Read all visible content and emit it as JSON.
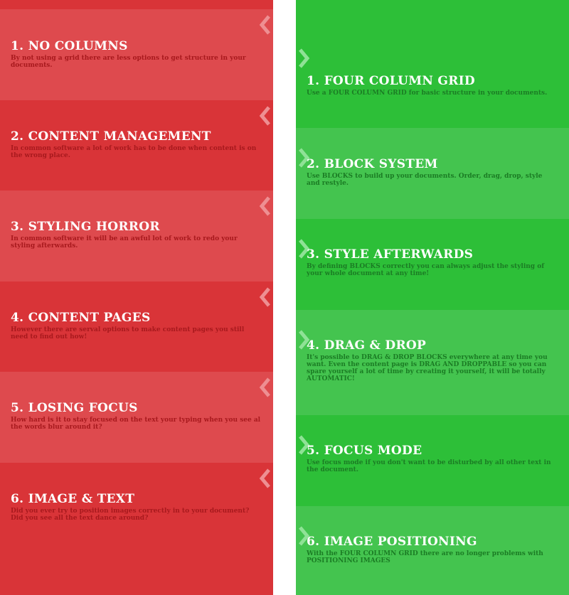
{
  "colors": {
    "problem_dark": "#d93438",
    "problem_light": "#de4a4e",
    "problem_text": "#a8191d",
    "solution_dark": "#2dbf38",
    "solution_light": "#44c44f",
    "solution_text": "#1b7c24",
    "title_text": "#ffffff"
  },
  "problems": {
    "icon": "chevron-left-icon",
    "items": [
      {
        "title": "1. NO COLUMNS",
        "description": "By not using a grid there are less options to get structure in your documents."
      },
      {
        "title": "2. CONTENT MANAGEMENT",
        "description": "In common software a lot of work has to be done when content is on the wrong place."
      },
      {
        "title": "3. STYLING HORROR",
        "description": "In common software it will be an awful lot of work to redo your styling afterwards."
      },
      {
        "title": "4. CONTENT PAGES",
        "description": "However there are serval options to make content pages you still need to find out how!"
      },
      {
        "title": "5. LOSING FOCUS",
        "description": "How hard is it to stay focused on the text your typing when you see al the words blur around it?"
      },
      {
        "title": "6. IMAGE & TEXT",
        "description": "Did you ever try to position images correctly in to your document? Did you see all the text dance around?"
      }
    ]
  },
  "solutions": {
    "icon": "chevron-right-icon",
    "items": [
      {
        "title": "1. FOUR COLUMN GRID",
        "description": "Use a FOUR COLUMN GRID for basic structure in your documents."
      },
      {
        "title": "2. BLOCK SYSTEM",
        "description": "Use BLOCKS to build up your documents. Order, drag, drop, style and restyle."
      },
      {
        "title": "3. STYLE AFTERWARDS",
        "description": "By defining BLOCKS correctly you can always adjust the styling of your whole document at any time!"
      },
      {
        "title": "4. DRAG & DROP",
        "description": "It's possible to DRAG & DROP BLOCKS everywhere at any time you want. Even the content page is DRAG AND DROPPABLE so you can spare yourself a lot of time by creating it yourself, it will be totally AUTOMATIC!"
      },
      {
        "title": "5. FOCUS MODE",
        "description": "Use focus mode if you don't want to be disturbed by all other text in the document."
      },
      {
        "title": "6. IMAGE POSITIONING",
        "description": "With the FOUR COLUMN GRID there are no longer problems with POSITIONING IMAGES"
      }
    ]
  }
}
